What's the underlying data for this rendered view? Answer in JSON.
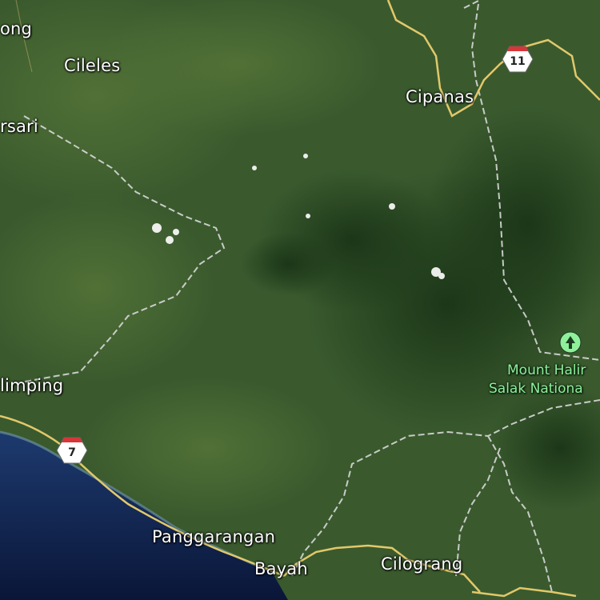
{
  "map": {
    "view": "satellite",
    "colors": {
      "road_primary": "#e2c86a",
      "boundary": "#d8d8d8",
      "ocean": "#0c1d46",
      "park_label": "#8ef09a",
      "place_label": "#ffffff"
    },
    "places": {
      "ong": "ong",
      "cileles": "Cileles",
      "rsari": "rsari",
      "cipanas": "Cipanas",
      "limping": "limping",
      "panggarangan": "Panggarangan",
      "bayah": "Bayah",
      "cilograng": "Cilograng"
    },
    "park": {
      "line1": "Mount Halir",
      "line2": "Salak Nationa",
      "icon": "tree-icon"
    },
    "shields": {
      "route_7": "7",
      "route_11": "11"
    }
  }
}
